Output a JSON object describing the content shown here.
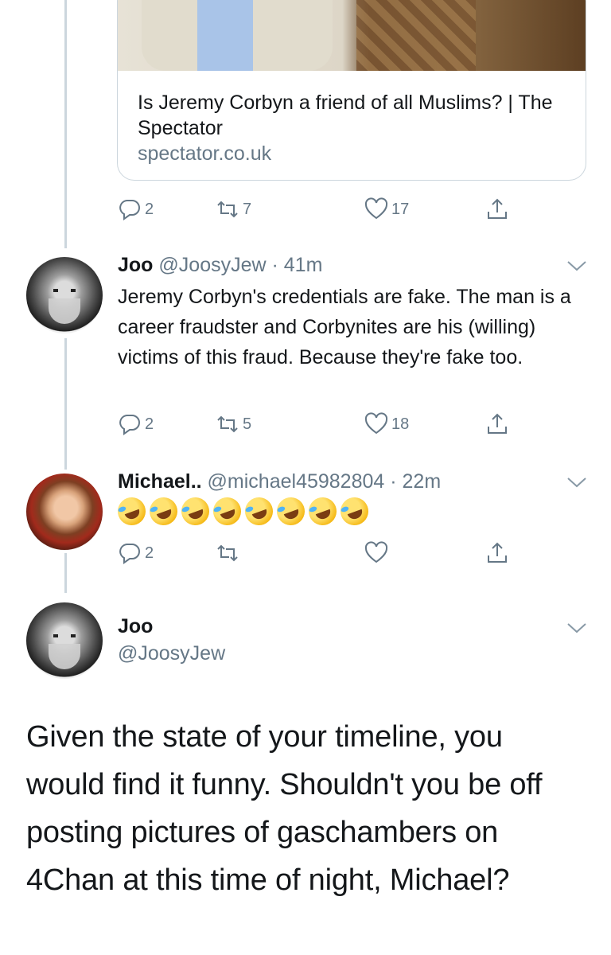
{
  "link_card": {
    "title": "Is Jeremy Corbyn a friend of all Muslims? | The Spectator",
    "domain": "spectator.co.uk"
  },
  "tweet_1": {
    "actions": {
      "replies": "2",
      "retweets": "7",
      "likes": "17"
    }
  },
  "tweet_2": {
    "name": "Joo",
    "handle": "@JoosyJew",
    "time": "41m",
    "text": "Jeremy Corbyn's credentials are fake. The man is a career fraudster and Corbynites are his (willing) victims of this fraud. Because they're fake too.",
    "actions": {
      "replies": "2",
      "retweets": "5",
      "likes": "18"
    }
  },
  "tweet_3": {
    "name": "Michael..",
    "handle": "@michael45982804",
    "time": "22m",
    "emoji_count": 8,
    "emoji_name": "rolling-on-the-floor-laughing",
    "actions": {
      "replies": "2",
      "retweets": "",
      "likes": ""
    }
  },
  "main_tweet": {
    "name": "Joo",
    "handle": "@JoosyJew",
    "text": "Given the state of your timeline, you would find it funny. Shouldn't you be off posting pictures of gaschambers on 4Chan at this time of night, Michael?"
  },
  "icons": [
    "reply-icon",
    "retweet-icon",
    "like-icon",
    "share-icon",
    "chevron-down-icon"
  ],
  "colors": {
    "secondary_text": "#657786",
    "border": "#ccd6dd",
    "primary_text": "#14171a"
  }
}
